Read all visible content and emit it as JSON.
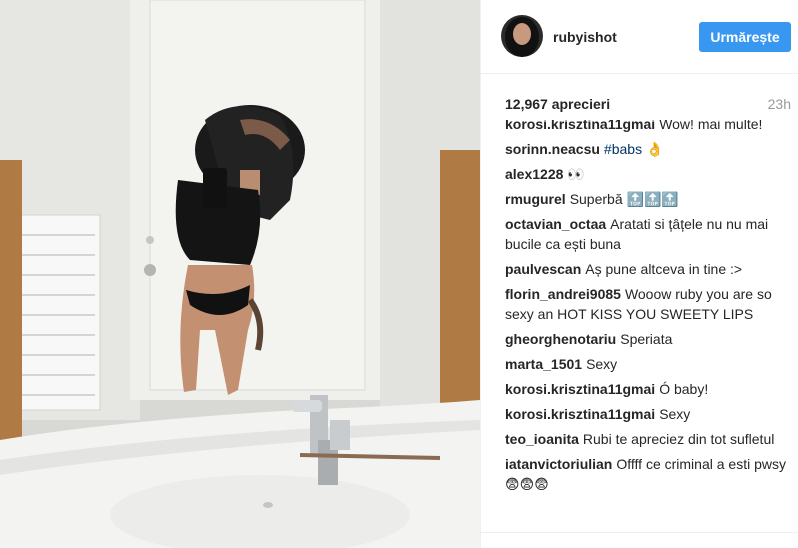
{
  "post": {
    "username": "rubyishot",
    "follow_label": "Urmărește",
    "likes": "12,967 aprecieri",
    "time": "23h"
  },
  "comments": [
    {
      "user": "korosi.krisztina11gmai",
      "text": "Wow! mai multe!"
    },
    {
      "user": "sorinn.neacsu",
      "tag": "#babs",
      "text": " 👌"
    },
    {
      "user": "alex1228",
      "text": "👀"
    },
    {
      "user": "rmugurel",
      "text": "Superbă 🔝🔝🔝"
    },
    {
      "user": "octavian_octaa",
      "text": "Aratati si țâțele nu nu mai bucile ca ești buna"
    },
    {
      "user": "paulvescan",
      "text": "Aș pune altceva in tine :>"
    },
    {
      "user": "florin_andrei9085",
      "text": "Wooow ruby you are so sexy an HOT KISS YOU SWEETY LIPS"
    },
    {
      "user": "gheorghenotariu",
      "text": "Speriata"
    },
    {
      "user": "marta_1501",
      "text": "Sexy"
    },
    {
      "user": "korosi.krisztina11gmai",
      "text": "Ó baby!"
    },
    {
      "user": "korosi.krisztina11gmai",
      "text": "Sexy"
    },
    {
      "user": "teo_ioanita",
      "text": "Rubi te apreciez din tot sufletul"
    },
    {
      "user": "iatanvictoriulian",
      "text": "Offff ce criminal a esti pwsy 😨😨😨"
    }
  ]
}
